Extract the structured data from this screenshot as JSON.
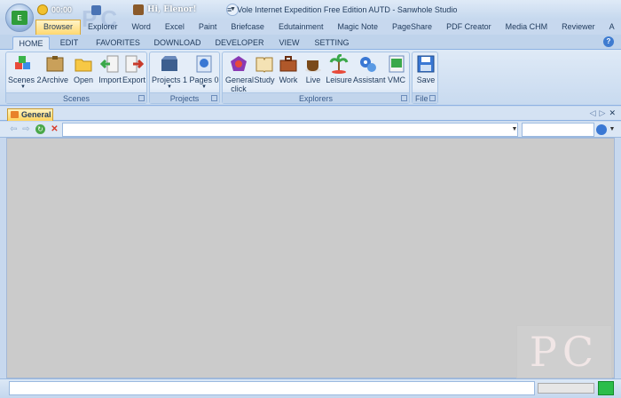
{
  "titlebar": {
    "clock": "00:00",
    "user": "Hi, Elenor!",
    "separator": "≡",
    "window_title": "Vole Internet Expedition Free Edition AUTD - Sanwhole Studio",
    "watermark": "PC"
  },
  "app_tabs": [
    "Browser",
    "Explorer",
    "Word",
    "Excel",
    "Paint",
    "Briefcase",
    "Edutainment",
    "Magic Note",
    "PageShare",
    "PDF Creator",
    "Media CHM",
    "Reviewer",
    "A"
  ],
  "ribbon_tabs": [
    "HOME",
    "EDIT",
    "FAVORITES",
    "DOWNLOAD",
    "DEVELOPER",
    "VIEW",
    "SETTING"
  ],
  "help": "?",
  "ribbon": {
    "scenes": {
      "label": "Scenes",
      "buttons": [
        "Scenes 2",
        "Archive",
        "Open",
        "Import",
        "Export"
      ]
    },
    "projects": {
      "label": "Projects",
      "buttons": [
        "Projects 1",
        "Pages 0"
      ]
    },
    "explorers": {
      "label": "Explorers",
      "buttons": [
        "General click",
        "Study",
        "Work",
        "Live",
        "Leisure",
        "Assistant",
        "VMC"
      ]
    },
    "file": {
      "label": "File",
      "buttons": [
        "Save"
      ]
    }
  },
  "doc_tab": {
    "label": "General"
  },
  "doc_nav": {
    "prev": "◁",
    "next": "▷",
    "close": "✕"
  },
  "address_bar": {
    "url": "",
    "search": ""
  },
  "status_bar": {
    "text": "",
    "progress": 0
  },
  "watermark_bottom": "PC",
  "colors": {
    "accent": "#ffd870",
    "content": "#cbcbcb",
    "led": "#2bbd4a"
  }
}
